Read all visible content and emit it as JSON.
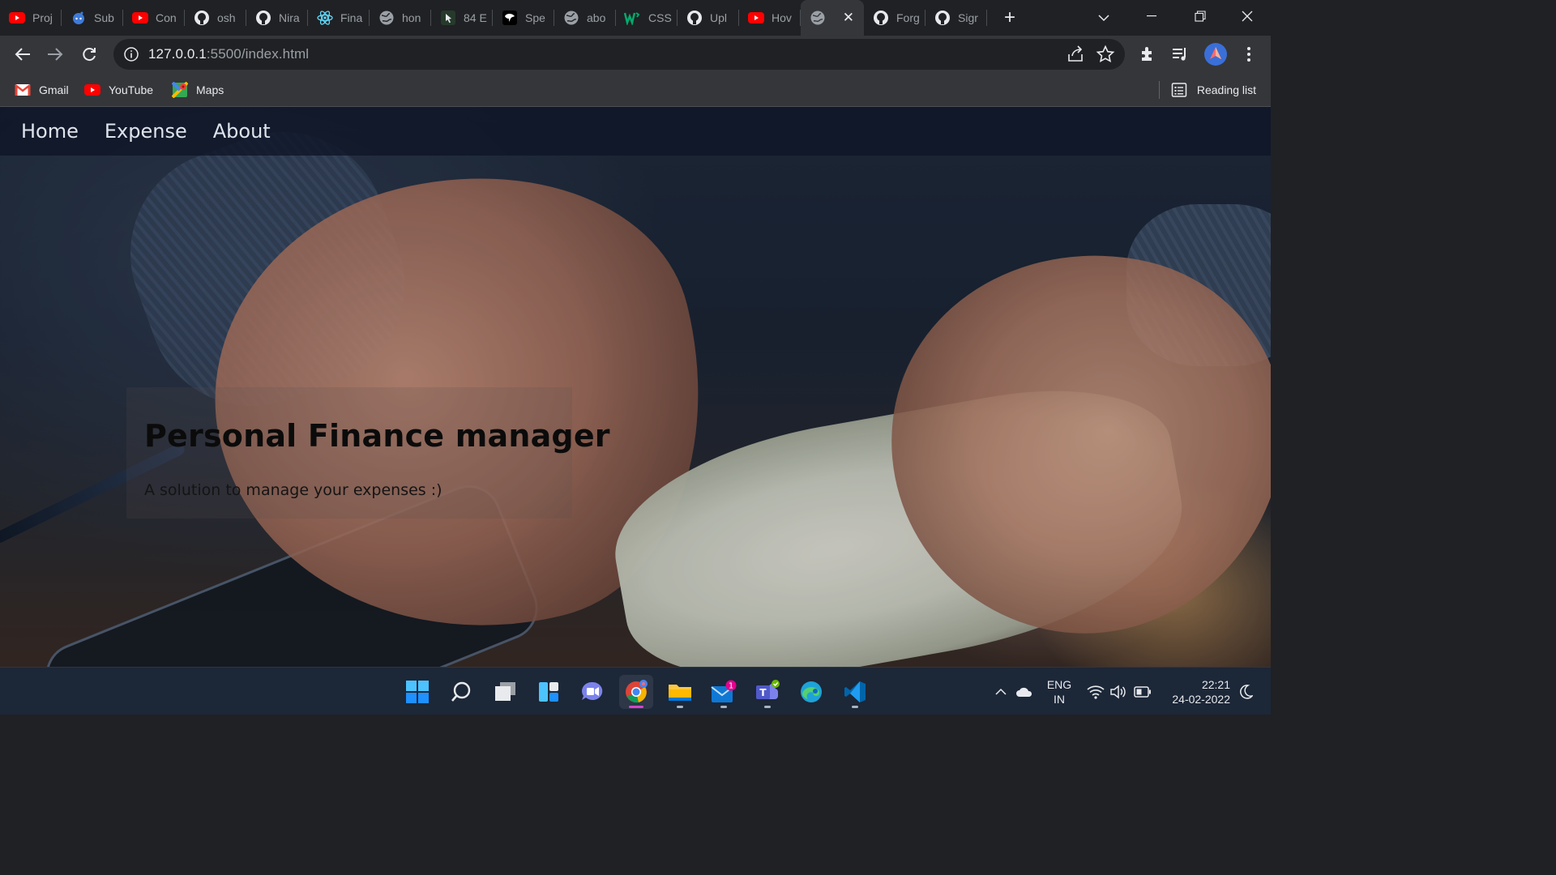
{
  "browser": {
    "tabs": [
      {
        "title": "Proj",
        "icon": "youtube-icon"
      },
      {
        "title": "Sub",
        "icon": "reddit-icon"
      },
      {
        "title": "Con",
        "icon": "youtube-icon"
      },
      {
        "title": "osh",
        "icon": "github-icon"
      },
      {
        "title": "Nira",
        "icon": "github-icon"
      },
      {
        "title": "Fina",
        "icon": "react-icon"
      },
      {
        "title": "hon",
        "icon": "globe-icon"
      },
      {
        "title": "84 E",
        "icon": "cursor-icon"
      },
      {
        "title": "Spe",
        "icon": "speech-icon"
      },
      {
        "title": "abo",
        "icon": "globe-icon"
      },
      {
        "title": "CSS",
        "icon": "w3schools-icon"
      },
      {
        "title": "Upl",
        "icon": "github-icon"
      },
      {
        "title": "Hov",
        "icon": "youtube-icon"
      },
      {
        "title": "",
        "icon": "globe-icon",
        "active": true
      },
      {
        "title": "Forg",
        "icon": "github-icon"
      },
      {
        "title": "Sigr",
        "icon": "github-icon"
      }
    ],
    "new_tab_label": "+",
    "url_host": "127.0.0.1",
    "url_rest": ":5500/index.html",
    "bookmarks": [
      {
        "label": "Gmail",
        "icon": "gmail-icon"
      },
      {
        "label": "YouTube",
        "icon": "youtube-icon"
      },
      {
        "label": "Maps",
        "icon": "maps-icon"
      }
    ],
    "reading_list_label": "Reading list"
  },
  "page": {
    "nav": [
      "Home",
      "Expense",
      "About"
    ],
    "hero_title": "Personal Finance manager",
    "hero_subtitle": "A solution to manage your expenses :)"
  },
  "taskbar": {
    "apps": [
      "start-icon",
      "search-icon",
      "task-view-icon",
      "widgets-icon",
      "chat-icon",
      "chrome-icon",
      "file-explorer-icon",
      "mail-icon",
      "teams-icon",
      "edge-icon",
      "vscode-icon"
    ],
    "mail_badge": "1",
    "language_line1": "ENG",
    "language_line2": "IN",
    "time": "22:21",
    "date": "24-02-2022"
  },
  "colors": {
    "accent_taskbar_active": "#d046c8",
    "browser_frame": "#202124",
    "toolbar": "#35363a"
  }
}
